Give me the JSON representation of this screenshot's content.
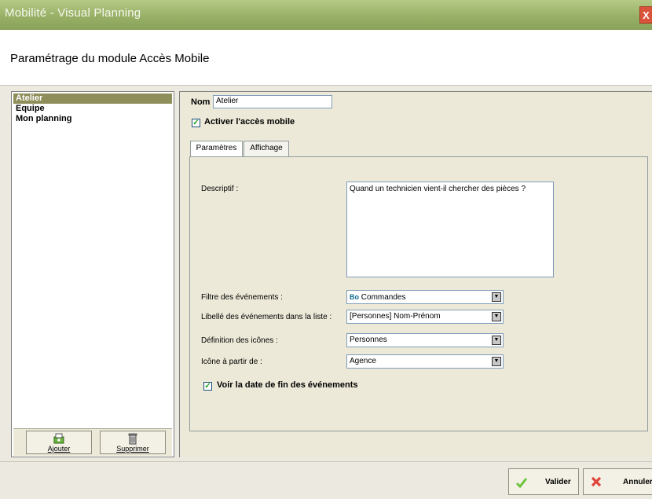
{
  "window": {
    "title": "Mobilité - Visual Planning",
    "close_label": "X"
  },
  "header": {
    "title": "Paramétrage du module Accès Mobile"
  },
  "sidebar": {
    "items": [
      {
        "label": "Atelier",
        "selected": true
      },
      {
        "label": "Equipe",
        "selected": false
      },
      {
        "label": "Mon planning",
        "selected": false
      }
    ],
    "add_label": "Ajouter",
    "delete_label": "Supprimer"
  },
  "form": {
    "name_label": "Nom",
    "name_value": "Atelier",
    "activate_label": "Activer l'accès mobile",
    "activate_checked": true
  },
  "tabs": [
    {
      "label": "Paramètres",
      "active": true
    },
    {
      "label": "Affichage",
      "active": false
    }
  ],
  "params": {
    "description_label": "Descriptif :",
    "description_value": "Quand un technicien vient-il chercher des pièces ?",
    "filter_label": "Filtre des événements :",
    "filter_value": "Commandes",
    "filter_icon": "bo-icon",
    "event_label_label": "Libellé des événements dans la liste :",
    "event_label_value": "[Personnes] Nom-Prénom",
    "icons_def_label": "Définition des icônes :",
    "icons_def_value": "Personnes",
    "icon_from_label": "Icône à partir de :",
    "icon_from_value": "Agence",
    "show_end_label": "Voir la date de fin des événements",
    "show_end_checked": true
  },
  "footer": {
    "validate_label": "Valider",
    "cancel_label": "Annuler"
  },
  "colors": {
    "titlebar": "#98b066",
    "selection": "#8e8e5a",
    "validate_icon": "#6fc23f",
    "cancel_icon": "#e0443a"
  }
}
